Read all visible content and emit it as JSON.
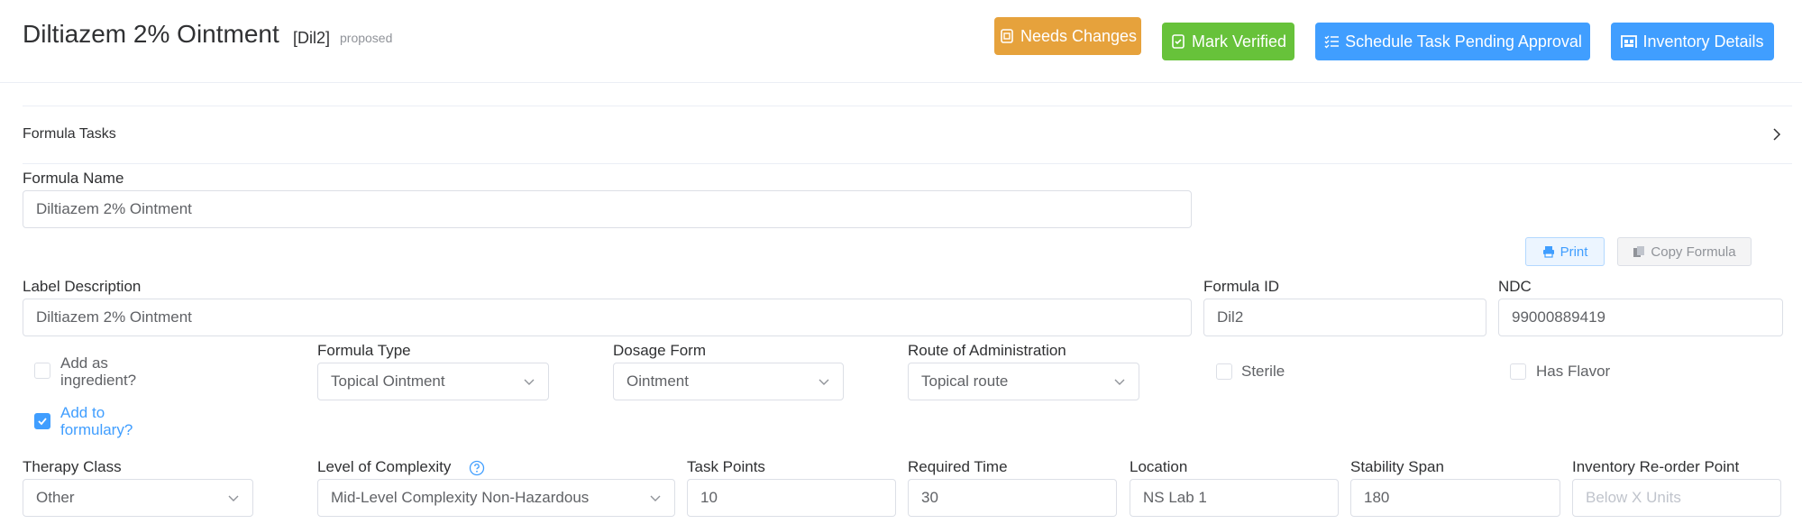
{
  "header": {
    "title": "Diltiazem 2% Ointment",
    "code": "[Dil2]",
    "status": "proposed",
    "buttons": {
      "needs_changes": "Needs Changes",
      "mark_verified": "Mark Verified",
      "schedule": "Schedule Task Pending Approval",
      "inventory": "Inventory Details"
    }
  },
  "collapse": {
    "title": "Formula Tasks"
  },
  "form": {
    "formula_name": {
      "label": "Formula Name",
      "value": "Diltiazem 2% Ointment"
    },
    "actions": {
      "print": "Print",
      "copy": "Copy Formula"
    },
    "label_description": {
      "label": "Label Description",
      "value": "Diltiazem 2% Ointment"
    },
    "formula_id": {
      "label": "Formula ID",
      "value": "Dil2"
    },
    "ndc": {
      "label": "NDC",
      "value": "99000889419"
    },
    "add_as_ingredient": {
      "label_line1": "Add as",
      "label_line2": "ingredient?",
      "checked": false
    },
    "add_to_formulary": {
      "label_line1": "Add to",
      "label_line2": "formulary?",
      "checked": true
    },
    "formula_type": {
      "label": "Formula Type",
      "value": "Topical Ointment"
    },
    "dosage_form": {
      "label": "Dosage Form",
      "value": "Ointment"
    },
    "route": {
      "label": "Route of Administration",
      "value": "Topical route"
    },
    "sterile": {
      "label": "Sterile",
      "checked": false
    },
    "has_flavor": {
      "label": "Has Flavor",
      "checked": false
    },
    "therapy_class": {
      "label": "Therapy Class",
      "value": "Other"
    },
    "complexity": {
      "label": "Level of Complexity",
      "value": "Mid-Level Complexity Non-Hazardous"
    },
    "task_points": {
      "label": "Task Points",
      "value": "10"
    },
    "required_time": {
      "label": "Required Time",
      "value": "30"
    },
    "location": {
      "label": "Location",
      "value": "NS Lab 1"
    },
    "stability_span": {
      "label": "Stability Span",
      "value": "180"
    },
    "reorder_point": {
      "label": "Inventory Re-order Point",
      "placeholder": "Below X Units"
    }
  },
  "colors": {
    "warning": "#e6a23c",
    "success": "#67c23a",
    "primary": "#409eff",
    "border": "#dcdfe6",
    "text": "#303133"
  }
}
